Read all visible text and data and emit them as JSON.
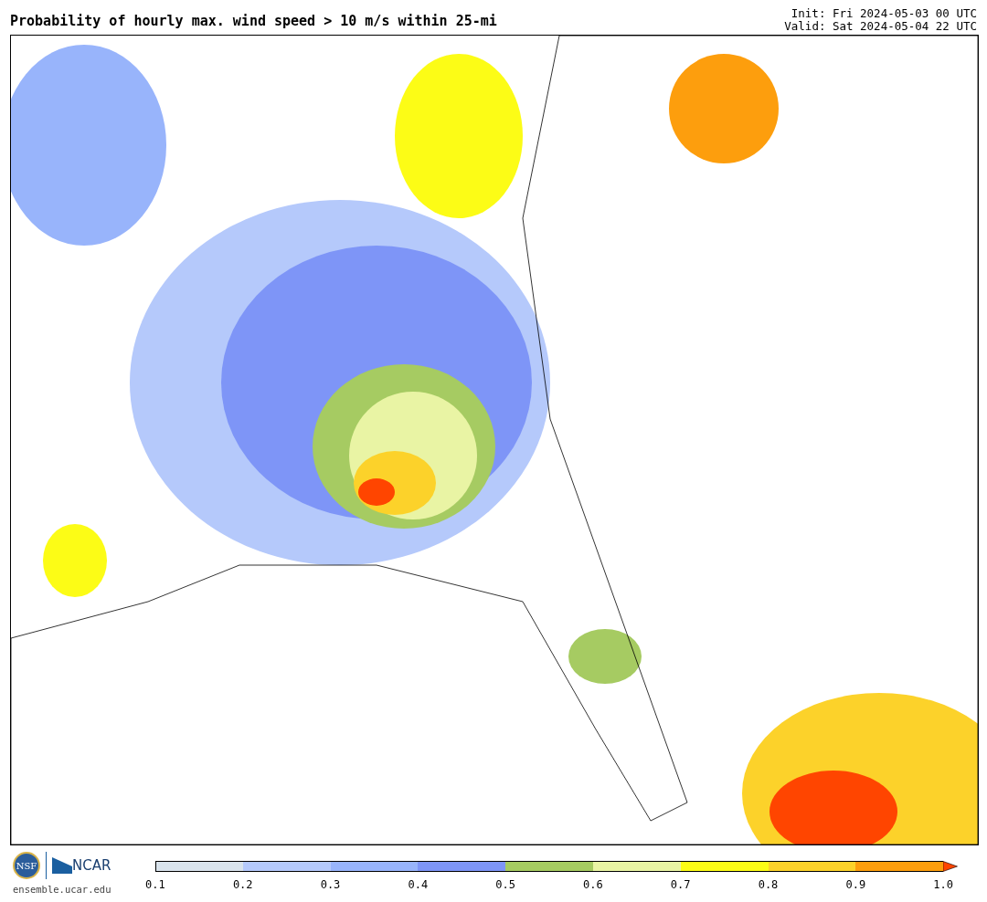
{
  "title": "Probability of hourly max. wind speed > 10 m/s within 25-mi",
  "init": "Init: Fri 2024-05-03 00 UTC",
  "valid": "Valid: Sat 2024-05-04 22 UTC",
  "logos": {
    "nsf": "NSF",
    "ncar": "NCAR",
    "site": "ensemble.ucar.edu"
  },
  "colorbar": {
    "segments": [
      {
        "color": "#d9e3ec"
      },
      {
        "color": "#b5c9fb"
      },
      {
        "color": "#98b4fb"
      },
      {
        "color": "#7e95f7"
      },
      {
        "color": "#a6cb62"
      },
      {
        "color": "#e9f4a4"
      },
      {
        "color": "#fcfc16"
      },
      {
        "color": "#fcd22a"
      },
      {
        "color": "#fd9e0d"
      }
    ],
    "arrow": {
      "color": "#ff4500"
    },
    "ticks": [
      "0.1",
      "0.2",
      "0.3",
      "0.4",
      "0.5",
      "0.6",
      "0.7",
      "0.8",
      "0.9",
      "1.0"
    ]
  }
}
